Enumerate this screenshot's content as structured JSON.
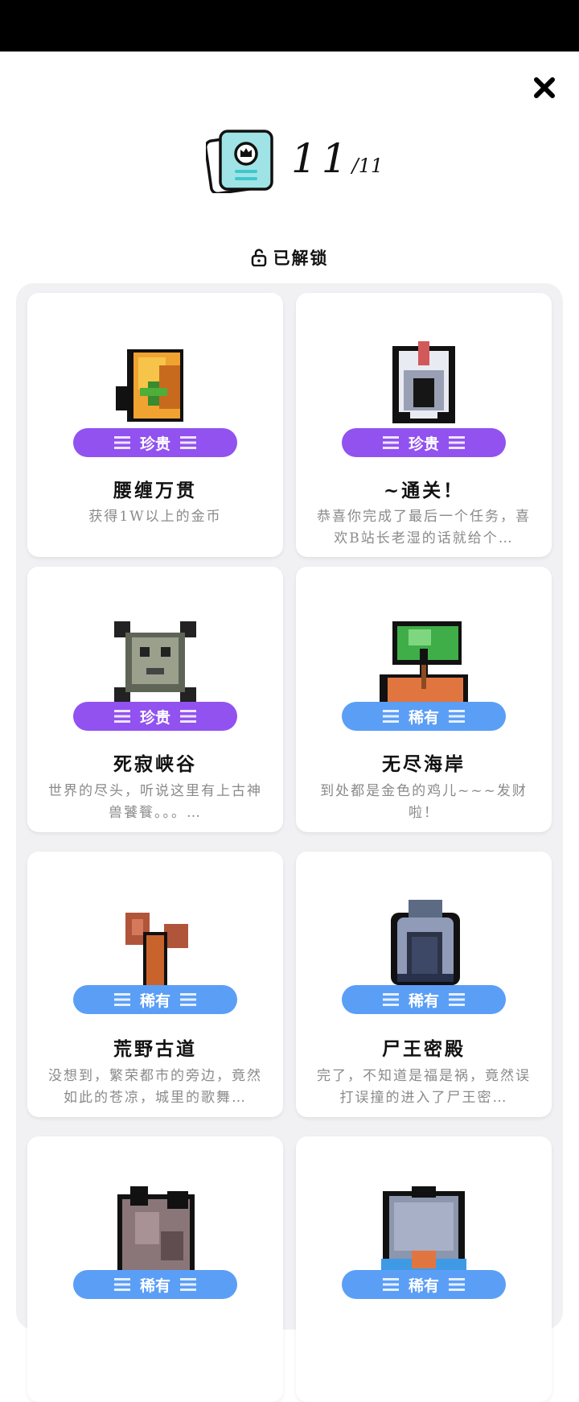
{
  "header": {
    "unlocked_count": "11",
    "total_count": "/11",
    "unlocked_label": "已解锁"
  },
  "colors": {
    "rare_purple": "#9152f0",
    "uncommon_blue": "#5b9ef6"
  },
  "icons": {
    "close": "close-icon",
    "card": "collection-card-icon",
    "lock": "unlocked-padlock-icon"
  },
  "achievements": [
    {
      "title": "腰缠万贯",
      "rarity": "珍贵",
      "desc": "获得1W以上的金币",
      "icon": "gold-coin-icon"
    },
    {
      "title": "~通关！",
      "rarity": "珍贵",
      "desc": "恭喜你完成了最后一个任务，喜欢B站长老湿的话就给个…",
      "icon": "helmet-icon"
    },
    {
      "title": "死寂峡谷",
      "rarity": "珍贵",
      "desc": "世界的尽头，听说这里有上古神兽饕餮。。。…",
      "icon": "crossed-bones-icon"
    },
    {
      "title": "无尽海岸",
      "rarity": "稀有",
      "desc": "到处都是金色的鸡儿~~~发财啦！",
      "icon": "palm-island-icon"
    },
    {
      "title": "荒野古道",
      "rarity": "稀有",
      "desc": "没想到，繁荣都市的旁边，竟然如此的苍凉，城里的歌舞…",
      "icon": "dead-tree-icon"
    },
    {
      "title": "尸王密殿",
      "rarity": "稀有",
      "desc": "完了，不知道是福是祸，竟然误打误撞的进入了尸王密…",
      "icon": "stone-arch-icon"
    },
    {
      "title": "",
      "rarity": "稀有",
      "desc": "",
      "icon": "rock-icon"
    },
    {
      "title": "",
      "rarity": "稀有",
      "desc": "",
      "icon": "castle-gate-icon"
    }
  ]
}
